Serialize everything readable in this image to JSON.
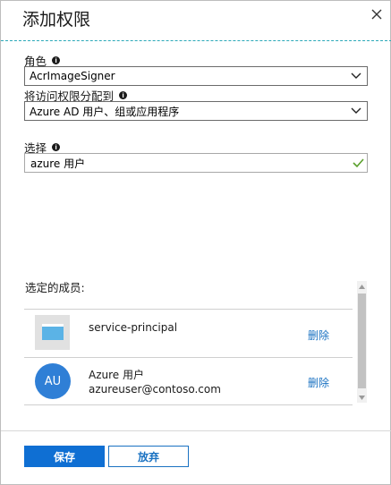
{
  "header": {
    "title": "添加权限"
  },
  "role": {
    "label": "角色",
    "value": "AcrImageSigner"
  },
  "assign_access": {
    "label": "将访问权限分配到",
    "value": "Azure AD 用户、组或应用程序"
  },
  "select": {
    "label": "选择",
    "value": "azure 用户"
  },
  "members": {
    "title": "选定的成员:",
    "items": [
      {
        "name": "service-principal",
        "action": "删除"
      },
      {
        "initials": "AU",
        "name": "Azure 用户",
        "email": "azureuser@contoso.com",
        "action": "删除"
      }
    ]
  },
  "footer": {
    "save_label": "保存",
    "discard_label": "放弃"
  },
  "colors": {
    "primary": "#0f6fd3",
    "link": "#1a72c2",
    "avatar": "#2f7fd6",
    "check": "#5aa02c",
    "divider_dashed": "#2aa8b8"
  }
}
